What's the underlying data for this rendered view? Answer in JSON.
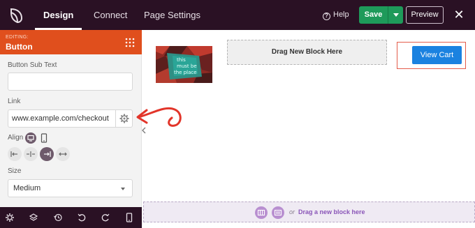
{
  "topbar": {
    "tabs": [
      {
        "label": "Design",
        "active": true
      },
      {
        "label": "Connect",
        "active": false
      },
      {
        "label": "Page Settings",
        "active": false
      }
    ],
    "help_label": "Help",
    "save_label": "Save",
    "preview_label": "Preview",
    "close_glyph": "✕"
  },
  "panel": {
    "editing_label": "EDITING:",
    "title": "Button",
    "sub_text_label": "Button Sub Text",
    "sub_text_value": "",
    "link_label": "Link",
    "link_value": "www.example.com/checkout",
    "align_label": "Align",
    "align_options": [
      "left",
      "center",
      "right",
      "full"
    ],
    "align_selected": "right",
    "size_label": "Size",
    "size_value": "Medium"
  },
  "bottombar": {
    "icons": [
      "gear-icon",
      "layers-icon",
      "history-icon",
      "undo-icon",
      "redo-icon",
      "mobile-icon"
    ]
  },
  "canvas": {
    "image_text": [
      "this",
      "must be",
      "the place"
    ],
    "drag_block_label": "Drag New Block Here",
    "button_label": "View Cart",
    "drop_or": "or",
    "drop_label": "Drag a new block here"
  },
  "colors": {
    "topbar_bg": "#2a1124",
    "panel_header": "#e04f1d",
    "save_green": "#1e9a5a",
    "button_blue": "#1b82e0",
    "highlight_red": "#e45c4a"
  }
}
